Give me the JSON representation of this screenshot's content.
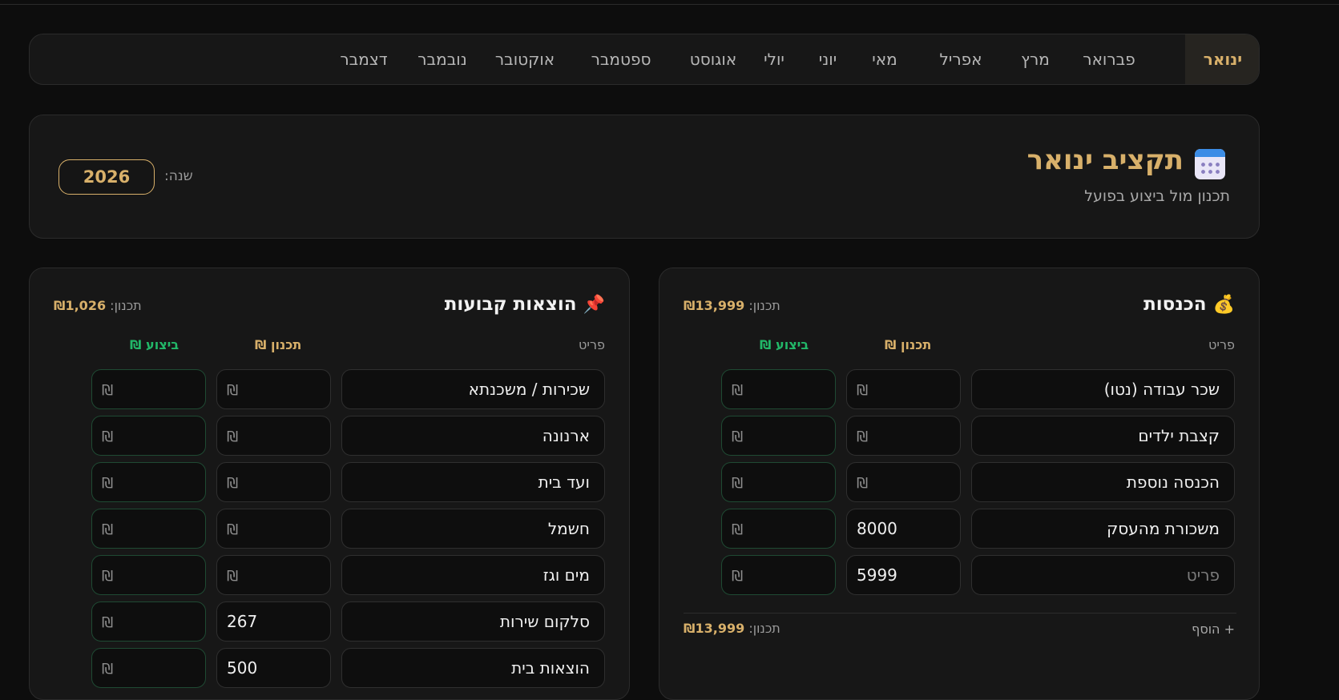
{
  "months": [
    "ינואר",
    "פברואר",
    "מרץ",
    "אפריל",
    "מאי",
    "יוני",
    "יולי",
    "אוגוסט",
    "ספטמבר",
    "אוקטובר",
    "נובמבר",
    "דצמבר"
  ],
  "active_month": "ינואר",
  "header": {
    "icon": "calendar-icon",
    "title": "תקציב ינואר",
    "subtitle": "תכנון מול ביצוע בפועל",
    "year_label": "שנה:",
    "year": "2026"
  },
  "columns": {
    "item": "פריט",
    "plan": "תכנון ₪",
    "actual": "ביצוע ₪"
  },
  "currency_symbol": "₪",
  "income": {
    "icon": "money-bag-icon",
    "emoji": "💰",
    "title": "הכנסות",
    "plan_label": "תכנון:",
    "plan_total": "₪13,999",
    "rows": [
      {
        "item": "שכר עבודה (נטו)",
        "plan": "",
        "actual": ""
      },
      {
        "item": "קצבת ילדים",
        "plan": "",
        "actual": ""
      },
      {
        "item": "הכנסה נוספת",
        "plan": "",
        "actual": ""
      },
      {
        "item": "משכורת מהעסק",
        "plan": "8000",
        "actual": ""
      },
      {
        "item": "",
        "item_placeholder": "פריט",
        "plan": "5999",
        "actual": ""
      }
    ],
    "add_label": "+ הוסף",
    "footer_label": "תכנון:",
    "footer_total": "₪13,999"
  },
  "fixed": {
    "icon": "pushpin-icon",
    "emoji": "📌",
    "title": "הוצאות קבועות",
    "plan_label": "תכנון:",
    "plan_total": "₪1,026",
    "rows": [
      {
        "item": "שכירות / משכנתא",
        "plan": "",
        "actual": ""
      },
      {
        "item": "ארנונה",
        "plan": "",
        "actual": ""
      },
      {
        "item": "ועד בית",
        "plan": "",
        "actual": ""
      },
      {
        "item": "חשמל",
        "plan": "",
        "actual": ""
      },
      {
        "item": "מים וגז",
        "plan": "",
        "actual": ""
      },
      {
        "item": "סלקום שירות",
        "plan": "267",
        "actual": ""
      },
      {
        "item": "הוצאות בית",
        "plan": "500",
        "actual": ""
      }
    ]
  },
  "colors": {
    "accent": "#d8b06a",
    "success": "#22b869",
    "background": "#0d0d0d",
    "card": "#171717"
  }
}
